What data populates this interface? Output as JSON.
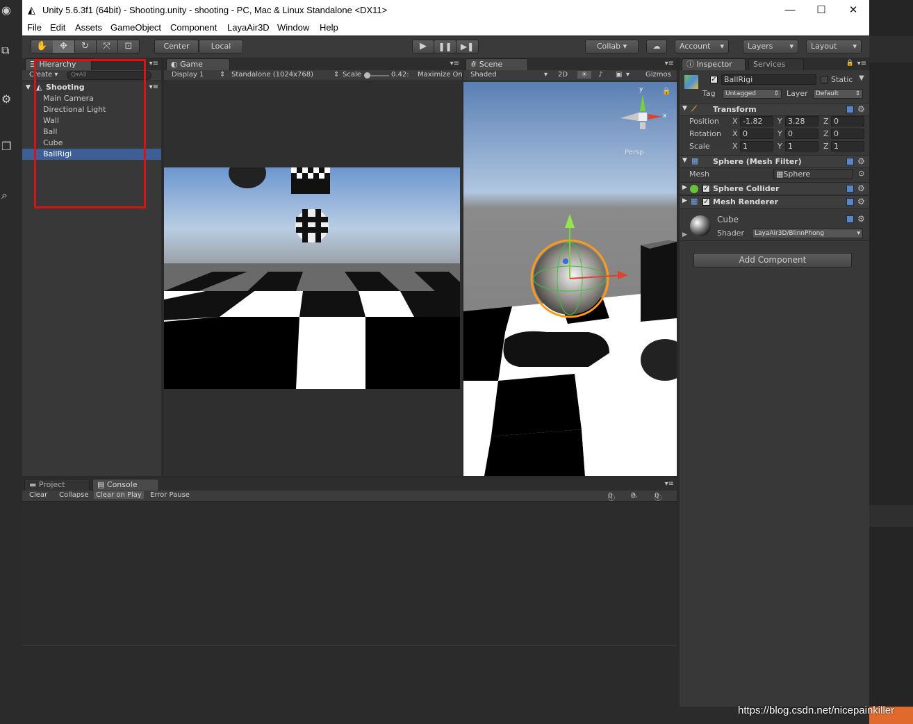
{
  "window": {
    "title": "Unity 5.6.3f1 (64bit) - Shooting.unity - shooting - PC, Mac & Linux Standalone <DX11>",
    "controls": [
      "—",
      "☐",
      "✕"
    ]
  },
  "menu": [
    "File",
    "Edit",
    "Assets",
    "GameObject",
    "Component",
    "LayaAir3D",
    "Window",
    "Help"
  ],
  "toolbar": {
    "tools": [
      "hand-tool",
      "move-tool",
      "rotate-tool",
      "scale-tool",
      "rect-tool"
    ],
    "pivot": "Center",
    "space": "Local",
    "collab": "Collab ▾",
    "account": "Account",
    "layers": "Layers",
    "layout": "Layout"
  },
  "hierarchy": {
    "tab": "Hierarchy",
    "create": "Create ▾",
    "search_placeholder": "Q▾All",
    "scene": "Shooting",
    "items": [
      "Main Camera",
      "Directional Light",
      "Wall",
      "Ball",
      "Cube",
      "BallRigi"
    ],
    "selected_index": 5
  },
  "game": {
    "tab": "Game",
    "display": "Display 1",
    "resolution": "Standalone (1024x768)",
    "scale_label": "Scale",
    "scale_value": "0.42:",
    "maximize": "Maximize On"
  },
  "scene_view": {
    "tab": "Scene",
    "shading": "Shaded",
    "mode_2d": "2D",
    "gizmos": "Gizmos",
    "persp": "Persp",
    "axis_x": "x",
    "axis_y": "y"
  },
  "inspector": {
    "tab": "Inspector",
    "services_tab": "Services",
    "object_name": "BallRigi",
    "static": "Static",
    "tag_label": "Tag",
    "tag": "Untagged",
    "layer_label": "Layer",
    "layer": "Default",
    "transform": {
      "title": "Transform",
      "position": {
        "label": "Position",
        "x": "-1.82",
        "y": "3.28",
        "z": "0"
      },
      "rotation": {
        "label": "Rotation",
        "x": "0",
        "y": "0",
        "z": "0"
      },
      "scale": {
        "label": "Scale",
        "x": "1",
        "y": "1",
        "z": "1"
      }
    },
    "mesh_filter": {
      "title": "Sphere (Mesh Filter)",
      "mesh_label": "Mesh",
      "mesh": "Sphere"
    },
    "sphere_collider": "Sphere Collider",
    "mesh_renderer": "Mesh Renderer",
    "material": {
      "name": "Cube",
      "shader_label": "Shader",
      "shader": "LayaAir3D/BlinnPhong"
    },
    "add_component": "Add Component"
  },
  "console": {
    "project_tab": "Project",
    "console_tab": "Console",
    "buttons": [
      "Clear",
      "Collapse",
      "Clear on Play",
      "Error Pause"
    ],
    "counts": {
      "info": "0",
      "warning": "0",
      "error": "0"
    }
  },
  "watermark": "https://blog.csdn.net/nicepainkiller"
}
